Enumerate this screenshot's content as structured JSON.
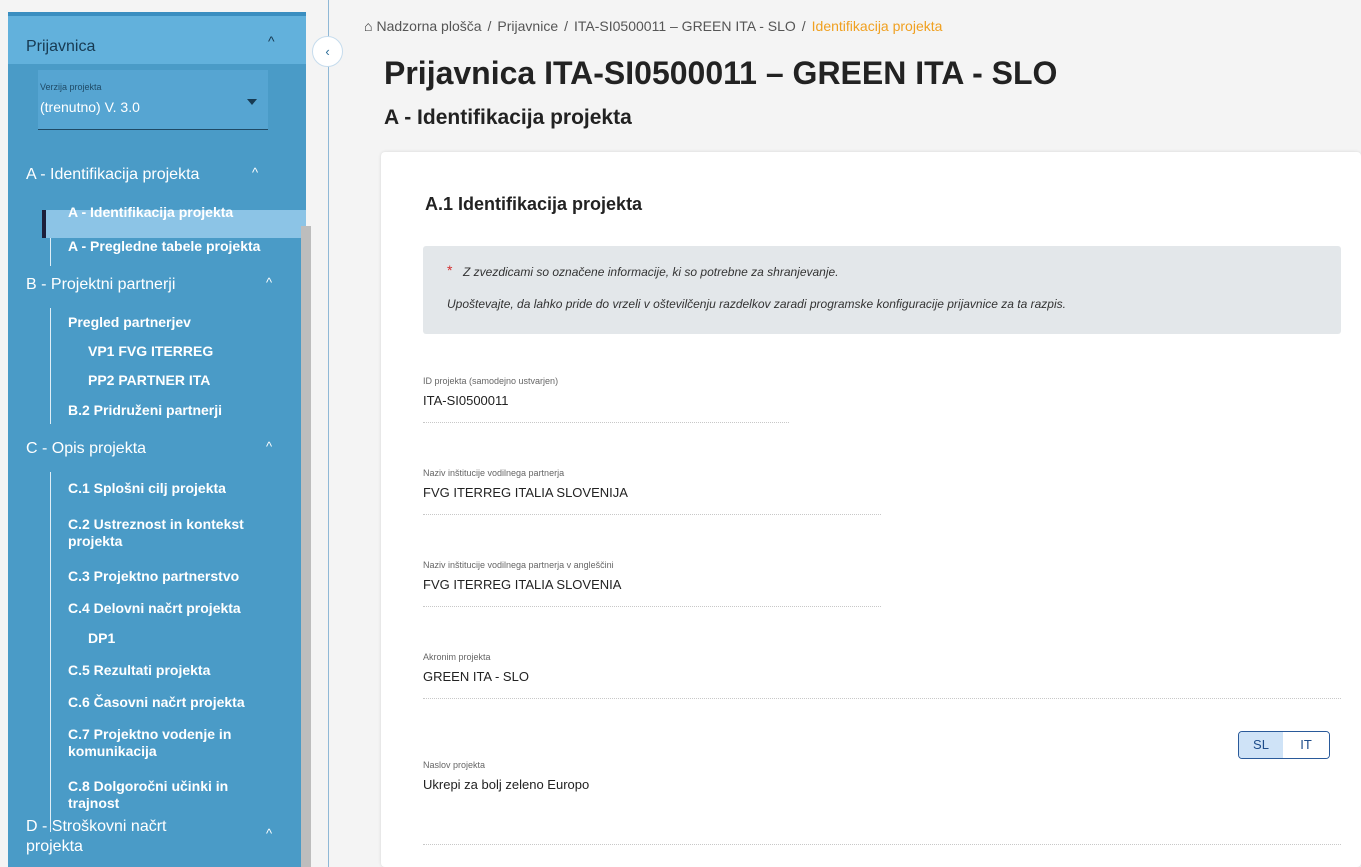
{
  "sidebar": {
    "header_title": "Prijavnica",
    "version_label": "Verzija projekta",
    "version_value": "(trenutno) V. 3.0",
    "sections": {
      "a": {
        "label": "A - Identifikacija projekta",
        "items": [
          "A - Identifikacija projekta",
          "A - Pregledne tabele projekta"
        ]
      },
      "b": {
        "label": "B - Projektni partnerji",
        "items": [
          "Pregled partnerjev",
          "VP1 FVG ITERREG",
          "PP2 PARTNER ITA",
          "B.2 Pridruženi partnerji"
        ]
      },
      "c": {
        "label": "C - Opis projekta",
        "items": [
          "C.1 Splošni cilj projekta",
          "C.2 Ustreznost in kontekst",
          "projekta",
          "C.3 Projektno partnerstvo",
          "C.4 Delovni načrt projekta",
          "DP1",
          "C.5 Rezultati projekta",
          "C.6 Časovni načrt projekta",
          "C.7 Projektno vodenje in",
          "komunikacija",
          "C.8 Dolgoročni učinki in",
          "trajnost"
        ]
      },
      "d": {
        "label_line1": "D - Stroškovni načrt",
        "label_line2": "projekta"
      }
    },
    "chevron_up": "^",
    "collapse_glyph": "‹"
  },
  "breadcrumb": {
    "home_glyph": "⌂",
    "items": [
      "Nadzorna plošča",
      "Prijavnice",
      "ITA-SI0500011 – GREEN ITA - SLO"
    ],
    "separator": "/",
    "current": "Identifikacija projekta"
  },
  "page": {
    "title": "Prijavnica ITA-SI0500011 – GREEN ITA - SLO",
    "subtitle": "A - Identifikacija projekta"
  },
  "card": {
    "title": "A.1 Identifikacija projekta",
    "notice": {
      "star": "*",
      "line1": "Z zvezdicami so označene informacije, ki so potrebne za shranjevanje.",
      "line2": "Upoštevajte, da lahko pride do vrzeli v oštevilčenju razdelkov zaradi programske konfiguracije prijavnice za ta razpis."
    },
    "fields": {
      "project_id": {
        "label": "ID projekta (samodejno ustvarjen)",
        "value": "ITA-SI0500011"
      },
      "lead_partner": {
        "label": "Naziv inštitucije vodilnega partnerja",
        "value": "FVG ITERREG ITALIA SLOVENIJA"
      },
      "lead_partner_en": {
        "label": "Naziv inštitucije vodilnega partnerja v angleščini",
        "value": "FVG ITERREG ITALIA SLOVENIA"
      },
      "acronym": {
        "label": "Akronim projekta",
        "value": "GREEN ITA - SLO"
      },
      "title": {
        "label": "Naslov projekta",
        "value": "Ukrepi za bolj zeleno Europo"
      }
    },
    "lang_toggle": {
      "sl": "SL",
      "it": "IT",
      "selected": "SL"
    }
  },
  "colors": {
    "sidebar_bg": "#4a9bc7",
    "sidebar_active": "#8cc4e6",
    "breadcrumb_current": "#f0a020",
    "required_star": "#d32f2f"
  }
}
